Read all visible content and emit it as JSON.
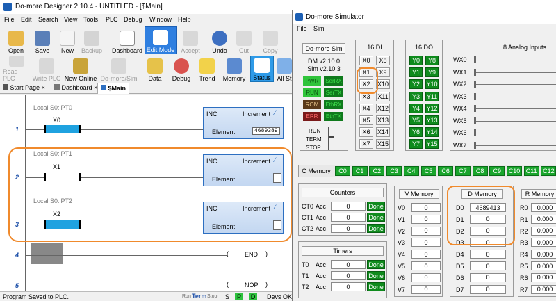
{
  "designer": {
    "title": "Do-more Designer 2.10.4 - UNTITLED - [$Main]",
    "menu": [
      "File",
      "Edit",
      "Search",
      "View",
      "Tools",
      "PLC",
      "Debug",
      "Window",
      "Help"
    ],
    "toolbar1": [
      "Open",
      "Save",
      "New",
      "Backup",
      "Dashboard",
      "Edit Mode",
      "Accept",
      "Undo",
      "Cut",
      "Copy"
    ],
    "toolbar2": [
      "Read PLC",
      "Write PLC",
      "New Online",
      "Do-more/Sim",
      "Data",
      "Debug",
      "Trend",
      "Memory",
      "Status",
      "All St"
    ],
    "tabs": [
      "Start Page",
      "Dashboard",
      "$Main"
    ],
    "rungs": [
      {
        "num": "1",
        "comment": "Local S0:iPT0",
        "contact": "X0",
        "op": "INC",
        "op_title": "Increment",
        "field": "Element",
        "field_value": "4689389"
      },
      {
        "num": "2",
        "comment": "Local S0:iPT1",
        "contact": "X1",
        "op": "INC",
        "op_title": "Increment",
        "field": "Element",
        "field_value": ""
      },
      {
        "num": "3",
        "comment": "Local S0:iPT2",
        "contact": "X2",
        "op": "INC",
        "op_title": "Increment",
        "field": "Element",
        "field_value": ""
      },
      {
        "num": "4",
        "coil": "END"
      },
      {
        "num": "5",
        "coil": "NOP"
      }
    ],
    "status": {
      "message": "Program Saved to PLC.",
      "run": "Run",
      "term": "Term",
      "stop": "Stop",
      "s": "S",
      "p": "P",
      "d": "D",
      "devs": "Devs OK"
    }
  },
  "sim": {
    "title": "Do-more Simulator",
    "menu": [
      "File",
      "Sim"
    ],
    "info": {
      "header": "Do-more Sim",
      "dm": "DM v2.10.0",
      "sim": "Sim v2.10.3"
    },
    "leds": [
      "PWR",
      "SerRX",
      "RUN",
      "SerTX",
      "ROM",
      "EthRX",
      "ERR",
      "EthTX"
    ],
    "switch": [
      "RUN",
      "TERM",
      "STOP"
    ],
    "di": {
      "header": "16 DI",
      "items": [
        "X0",
        "X8",
        "X1",
        "X9",
        "X2",
        "X10",
        "X3",
        "X11",
        "X4",
        "X12",
        "X5",
        "X13",
        "X6",
        "X14",
        "X7",
        "X15"
      ]
    },
    "do": {
      "header": "16 DO",
      "items": [
        "Y0",
        "Y8",
        "Y1",
        "Y9",
        "Y2",
        "Y10",
        "Y3",
        "Y11",
        "Y4",
        "Y12",
        "Y5",
        "Y13",
        "Y6",
        "Y14",
        "Y7",
        "Y15"
      ]
    },
    "analog": {
      "header": "8 Analog Inputs",
      "items": [
        "WX0",
        "WX1",
        "WX2",
        "WX3",
        "WX4",
        "WX5",
        "WX6",
        "WX7"
      ]
    },
    "cmem": {
      "label": "C Memory",
      "items": [
        "C0",
        "C1",
        "C2",
        "C3",
        "C4",
        "C5",
        "C6",
        "C7",
        "C8",
        "C9",
        "C10",
        "C11",
        "C12"
      ]
    },
    "counters": {
      "header": "Counters",
      "acc": "Acc",
      "done": "Done",
      "rows": [
        {
          "name": "CT0",
          "value": "0"
        },
        {
          "name": "CT1",
          "value": "0"
        },
        {
          "name": "CT2",
          "value": "0"
        }
      ]
    },
    "timers": {
      "header": "Timers",
      "acc": "Acc",
      "done": "Done",
      "rows": [
        {
          "name": "T0",
          "value": "0"
        },
        {
          "name": "T1",
          "value": "0"
        },
        {
          "name": "T2",
          "value": "0"
        }
      ]
    },
    "vmem": {
      "header": "V Memory",
      "rows": [
        {
          "name": "V0",
          "value": "0"
        },
        {
          "name": "V1",
          "value": "0"
        },
        {
          "name": "V2",
          "value": "0"
        },
        {
          "name": "V3",
          "value": "0"
        },
        {
          "name": "V4",
          "value": "0"
        },
        {
          "name": "V5",
          "value": "0"
        },
        {
          "name": "V6",
          "value": "0"
        },
        {
          "name": "V7",
          "value": "0"
        }
      ]
    },
    "dmem": {
      "header": "D Memory",
      "rows": [
        {
          "name": "D0",
          "value": "4689413"
        },
        {
          "name": "D1",
          "value": "0"
        },
        {
          "name": "D2",
          "value": "0"
        },
        {
          "name": "D3",
          "value": "0"
        },
        {
          "name": "D4",
          "value": "0"
        },
        {
          "name": "D5",
          "value": "0"
        },
        {
          "name": "D6",
          "value": "0"
        },
        {
          "name": "D7",
          "value": "0"
        }
      ]
    },
    "rmem": {
      "header": "R Memory",
      "rows": [
        {
          "name": "R0",
          "value": "0.000"
        },
        {
          "name": "R1",
          "value": "0.000"
        },
        {
          "name": "R2",
          "value": "0.000"
        },
        {
          "name": "R3",
          "value": "0.000"
        },
        {
          "name": "R4",
          "value": "0.000"
        },
        {
          "name": "R5",
          "value": "0.000"
        },
        {
          "name": "R6",
          "value": "0.000"
        },
        {
          "name": "R7",
          "value": "0.000"
        }
      ]
    }
  },
  "colors": {
    "accent": "#f08a2c",
    "led_green": "#19a52c",
    "instr_blue": "#2d6fc1"
  }
}
